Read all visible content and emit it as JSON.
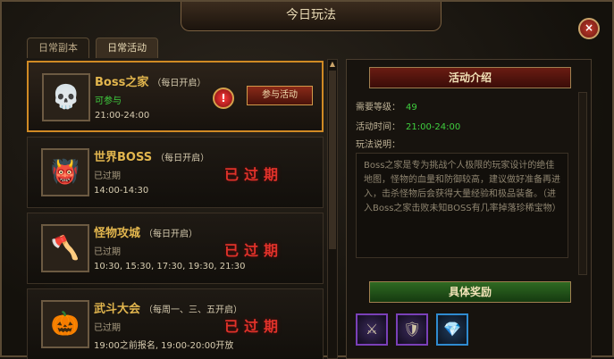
{
  "window": {
    "title": "今日玩法",
    "close_label": "×"
  },
  "tabs": [
    {
      "label": "日常副本",
      "active": false
    },
    {
      "label": "日常活动",
      "active": true
    }
  ],
  "events": [
    {
      "name": "Boss之家",
      "schedule": "（每日开启）",
      "status": "可参与",
      "time": "21:00-24:00",
      "join_label": "参与活动",
      "icon": "zombie-head-icon"
    },
    {
      "name": "世界BOSS",
      "schedule": "（每日开启）",
      "status": "已过期",
      "time": "14:00-14:30",
      "expired_label": "已过期",
      "icon": "blue-beast-icon"
    },
    {
      "name": "怪物攻城",
      "schedule": "（每日开启）",
      "status": "已过期",
      "time": "10:30, 15:30, 17:30, 19:30, 21:30",
      "expired_label": "已过期",
      "icon": "axe-monster-icon"
    },
    {
      "name": "武斗大会",
      "schedule": "（每周一、三、五开启）",
      "status": "已过期",
      "time": "19:00之前报名, 19:00-20:00开放",
      "expired_label": "已过期",
      "icon": "golden-head-icon"
    }
  ],
  "detail": {
    "intro_title": "活动介绍",
    "level_label": "需要等级：",
    "level_value": "49",
    "time_label": "活动时间：",
    "time_value": "21:00-24:00",
    "desc_label": "玩法说明：",
    "description": "Boss之家是专为挑战个人极限的玩家设计的绝佳地图，怪物的血量和防御较高，建议做好准备再进入，击杀怪物后会获得大量经验和极品装备。（进入Boss之家击败未知BOSS有几率掉落珍稀宝物）",
    "reward_title": "具体奖励"
  },
  "colors": {
    "accent_orange": "#d08a24",
    "status_green": "#3fcf3f",
    "expired_red": "#e0322a"
  }
}
